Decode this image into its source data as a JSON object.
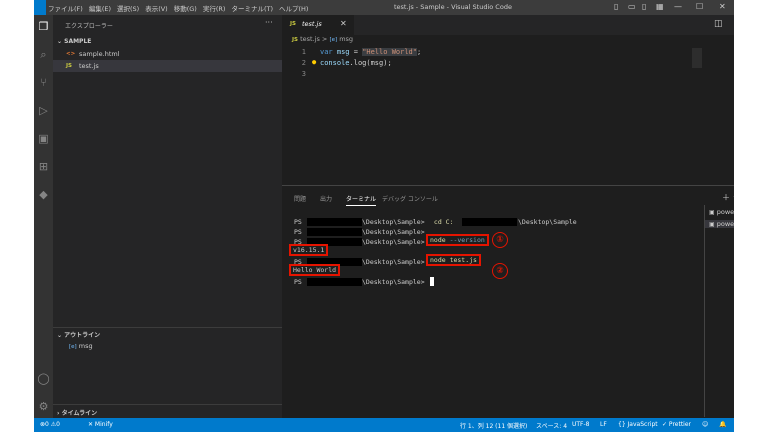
{
  "titlebar": {
    "menu": [
      "ファイル(F)",
      "編集(E)",
      "選択(S)",
      "表示(V)",
      "移動(G)",
      "実行(R)",
      "ターミナル(T)",
      "ヘルプ(H)"
    ],
    "title": "test.js - Sample - Visual Studio Code"
  },
  "sidebar": {
    "header": "エクスプローラー",
    "folder": "SAMPLE",
    "files": [
      {
        "icon": "<>",
        "name": "sample.html",
        "color": "#e37933"
      },
      {
        "icon": "JS",
        "name": "test.js",
        "color": "#cbcb41"
      }
    ],
    "outline_header": "アウトライン",
    "outline_item_icon": "[e]",
    "outline_item": "msg",
    "timeline_header": "タイムライン"
  },
  "editor": {
    "tab_icon": "JS",
    "tab_label": "test.js",
    "breadcrumb_file": "test.js",
    "breadcrumb_sep": ">",
    "breadcrumb_symbol_icon": "[e]",
    "breadcrumb_symbol": "msg",
    "line_numbers": [
      "1",
      "2",
      "3"
    ],
    "line1": {
      "kw": "var",
      "var": "msg",
      "eq": " = ",
      "str": "\"Hello World\"",
      "end": ";"
    },
    "line2": {
      "fn": "console",
      "rest": ".log(msg);"
    }
  },
  "panel": {
    "tabs": [
      "問題",
      "出力",
      "ターミナル",
      "デバッグ コンソール"
    ],
    "active_tab": "ターミナル",
    "terminals": [
      "powershell",
      "powershell"
    ],
    "lines": [
      {
        "prefix": "PS",
        "path": "\\Desktop\\Sample>",
        "cmd": " cd C:",
        "tail": "\\Desktop\\Sample"
      },
      {
        "prefix": "PS",
        "path": "\\Desktop\\Sample>",
        "cmd": "",
        "tail": ""
      },
      {
        "prefix": "PS",
        "path": "\\Desktop\\Sample>",
        "cmd": "",
        "tail": ""
      }
    ],
    "cmd_version": {
      "name": "node",
      "arg": " --version"
    },
    "out_version": "v16.15.1",
    "line4": {
      "prefix": "PS",
      "path": "\\Desktop\\Sample>"
    },
    "cmd_run": "node test.js",
    "out_run": "Hello World",
    "line_last": {
      "prefix": "PS",
      "path": "\\Desktop\\Sample>"
    },
    "marker1": "①",
    "marker2": "②"
  },
  "status": {
    "errors": "⊗0 ⚠0",
    "minify": "✕ Minify",
    "position": "行 1、列 12 (11 個選択)",
    "spaces": "スペース: 4",
    "encoding": "UTF-8",
    "eol": "LF",
    "language": "{} JavaScript",
    "prettier": "✓ Prettier"
  },
  "colors": {
    "accent": "#007acc",
    "highlight_border": "#e51400"
  }
}
